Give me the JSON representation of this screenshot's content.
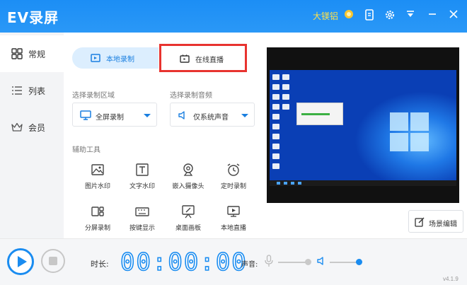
{
  "app": {
    "title": "EV录屏",
    "user": "大镁铝",
    "version": "v4.1.9"
  },
  "sidebar": {
    "items": [
      {
        "label": "常规",
        "icon": "grid-icon",
        "active": true
      },
      {
        "label": "列表",
        "icon": "list-icon",
        "active": false
      },
      {
        "label": "会员",
        "icon": "crown-icon",
        "active": false
      }
    ]
  },
  "modes": {
    "local": "本地录制",
    "live": "在线直播",
    "active": "live"
  },
  "labels": {
    "region": "选择录制区域",
    "audio": "选择录制音频",
    "tools": "辅助工具"
  },
  "selects": {
    "region_value": "全屏录制",
    "audio_value": "仅系统声音"
  },
  "tools": [
    {
      "label": "图片水印",
      "icon": "image-icon"
    },
    {
      "label": "文字水印",
      "icon": "text-icon"
    },
    {
      "label": "嵌入摄像头",
      "icon": "webcam-icon"
    },
    {
      "label": "定时录制",
      "icon": "alarm-icon"
    },
    {
      "label": "分屏录制",
      "icon": "split-screen-icon"
    },
    {
      "label": "按键显示",
      "icon": "keyboard-icon"
    },
    {
      "label": "桌面画板",
      "icon": "drawing-board-icon"
    },
    {
      "label": "本地直播",
      "icon": "local-live-icon"
    }
  ],
  "scene_button": "场景编辑",
  "bottom": {
    "duration_label": "时长:",
    "timer": "00:00:00",
    "volume_label": "声音:"
  },
  "colors": {
    "accent": "#1a8cf0",
    "highlight_border": "#e8332f",
    "user_name": "#ffe24a"
  }
}
